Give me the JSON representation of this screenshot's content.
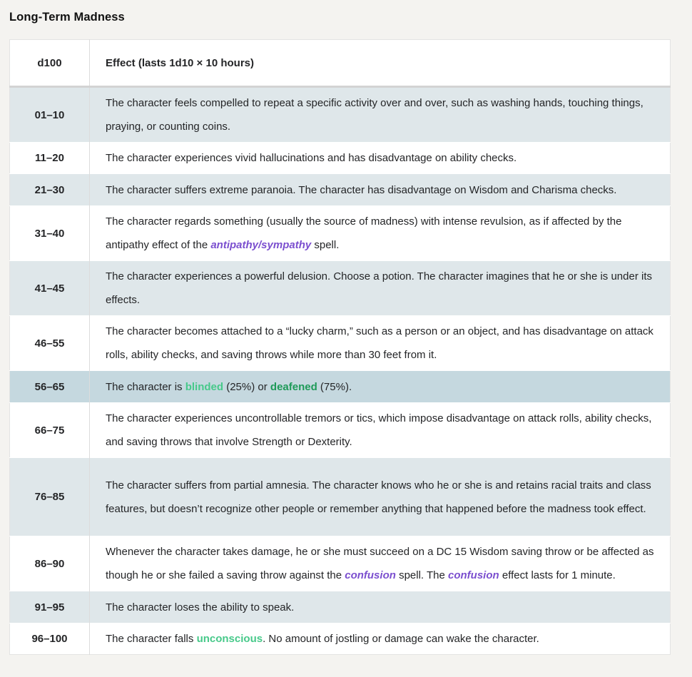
{
  "heading": "Long-Term Madness",
  "table": {
    "col_roll": "d100",
    "col_effect": "Effect (lasts 1d10 × 10 hours)",
    "rows": [
      {
        "roll": "01–10",
        "text": "The character feels compelled to repeat a specific activity over and over, such as washing hands, touching things, praying, or counting coins."
      },
      {
        "roll": "11–20",
        "text": "The character experiences vivid hallucinations and has disadvantage on ability checks."
      },
      {
        "roll": "21–30",
        "text": "The character suffers extreme paranoia. The character has disadvantage on Wisdom and Charisma checks."
      },
      {
        "roll": "31–40",
        "text_a": "The character regards something (usually the source of madness) with intense revulsion, as if affected by the antipathy effect of the ",
        "link": "antipathy/sympathy",
        "text_b": " spell."
      },
      {
        "roll": "41–45",
        "text": "The character experiences a powerful delusion. Choose a potion. The character imagines that he or she is under its effects."
      },
      {
        "roll": "46–55",
        "text": "The character becomes attached to a “lucky charm,” such as a person or an object, and has disadvantage on attack rolls, ability checks, and saving throws while more than 30 feet from it."
      },
      {
        "roll": "56–65",
        "text_a": "The character is ",
        "link_a": "blinded",
        "text_b": " (25%) or ",
        "link_b": "deafened",
        "text_c": " (75%)."
      },
      {
        "roll": "66–75",
        "text": "The character experiences uncontrollable tremors or tics, which impose disadvantage on attack rolls, ability checks, and saving throws that involve Strength or Dexterity."
      },
      {
        "roll": "76–85",
        "text": "The character suffers from partial amnesia. The character knows who he or she is and retains racial traits and class features, but doesn’t recognize other people or remember anything that happened before the madness took effect."
      },
      {
        "roll": "86–90",
        "text_a": "Whenever the character takes damage, he or she must succeed on a DC 15 Wisdom saving throw or be affected as though he or she failed a saving throw against the ",
        "link_a": "confusion",
        "text_b": " spell. The ",
        "link_b": "confusion",
        "text_c": " effect lasts for 1 minute."
      },
      {
        "roll": "91–95",
        "text": "The character loses the ability to speak."
      },
      {
        "roll": "96–100",
        "text_a": "The character falls ",
        "link": "unconscious",
        "text_b": ". No amount of jostling or damage can wake the character."
      }
    ]
  }
}
